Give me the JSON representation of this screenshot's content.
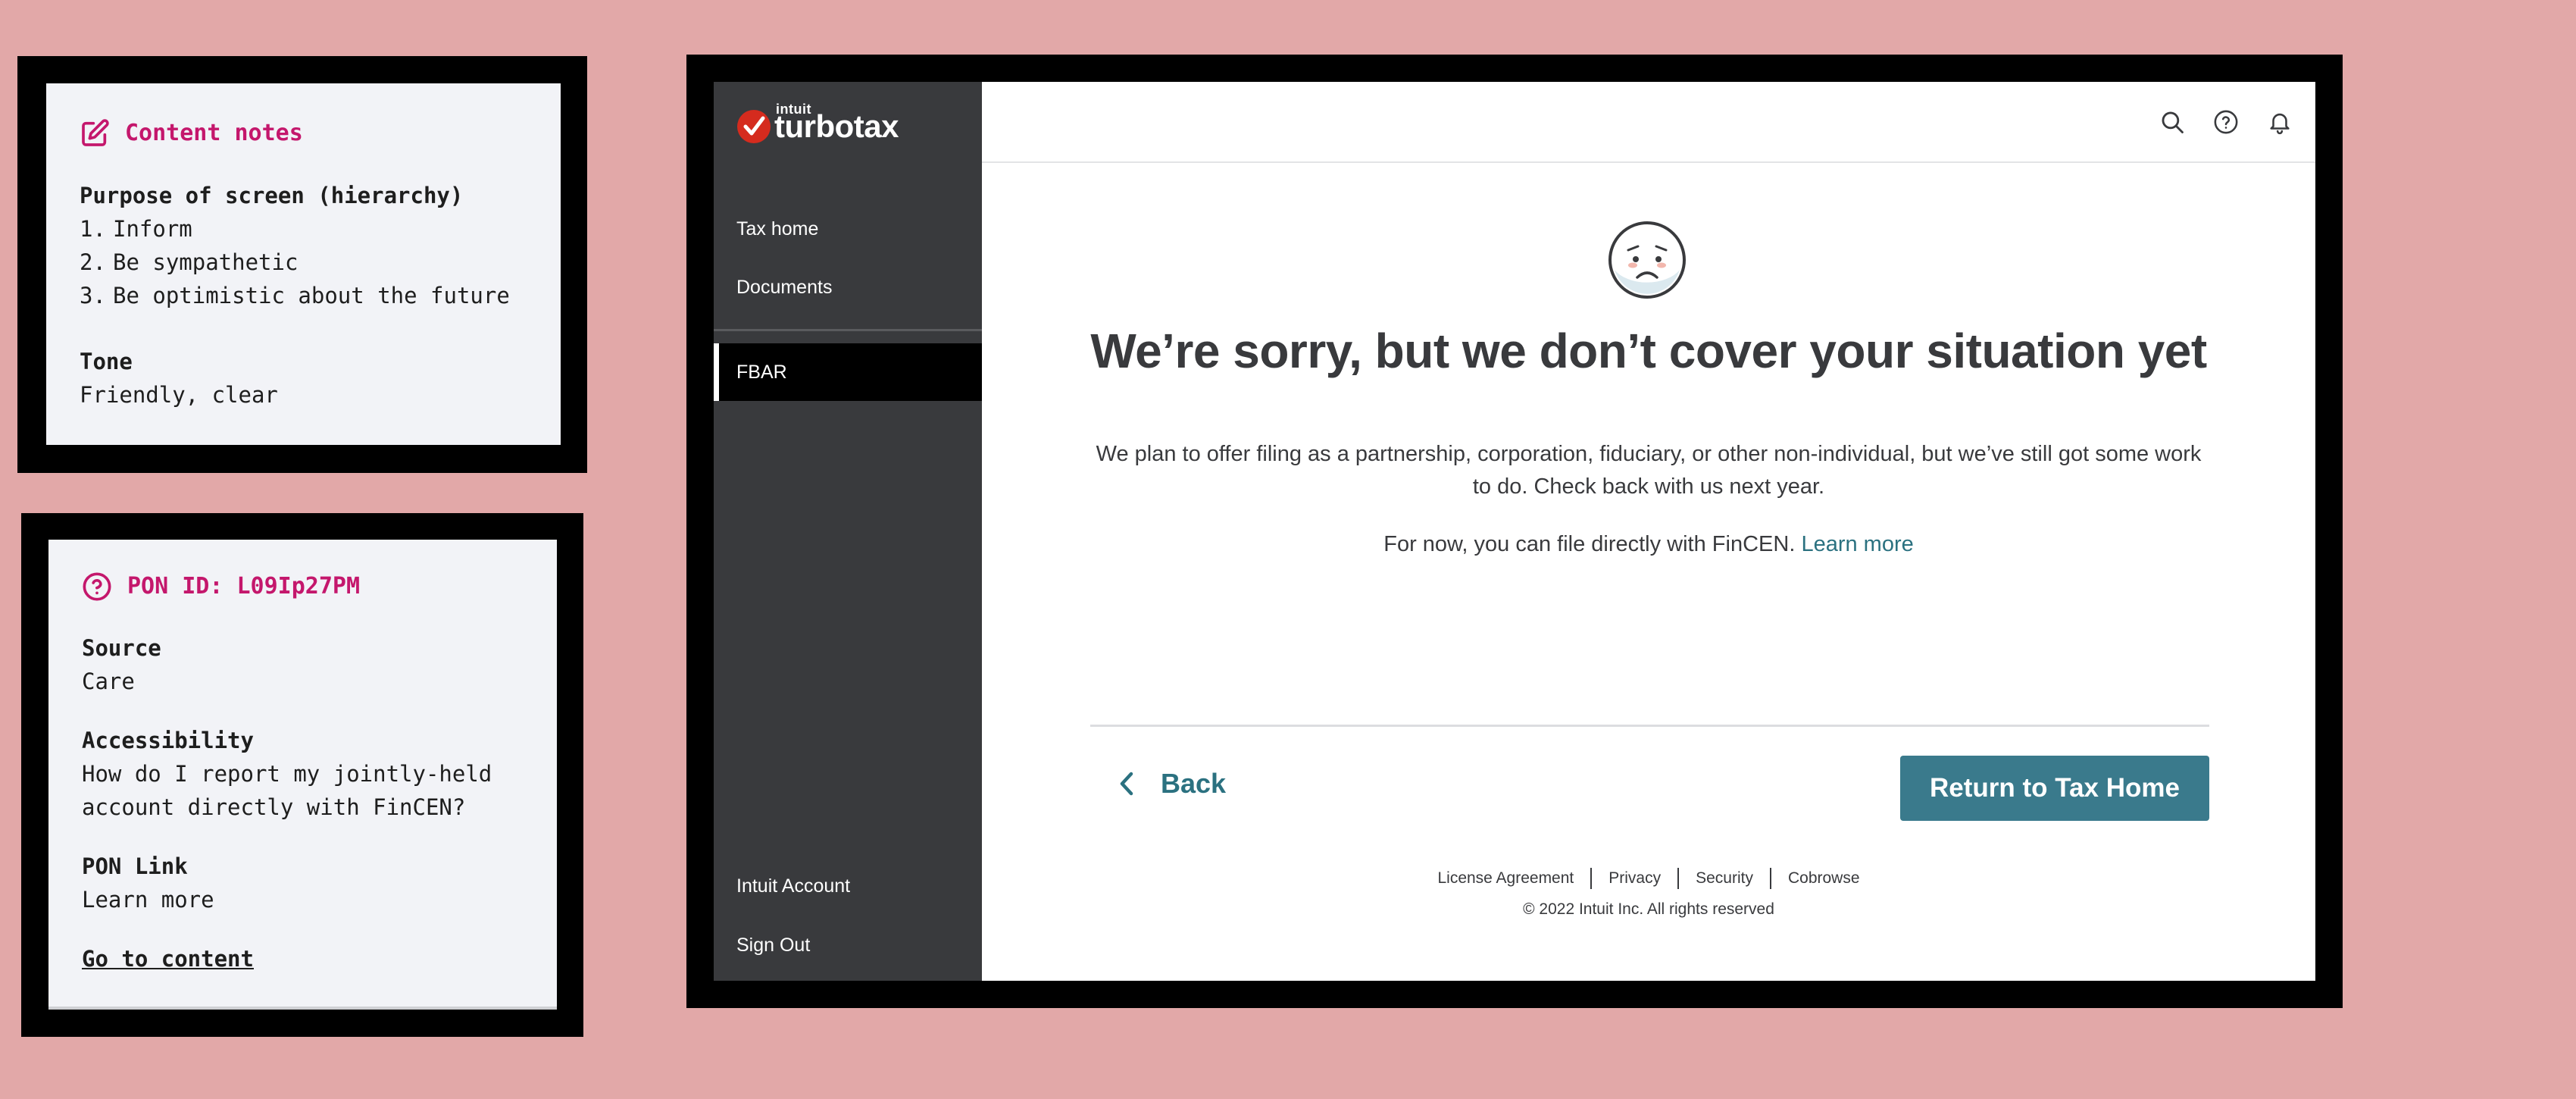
{
  "content_notes": {
    "title": "Content notes",
    "purpose_label": "Purpose of screen (hierarchy)",
    "purpose_items": [
      {
        "num": "1.",
        "text": "Inform"
      },
      {
        "num": "2.",
        "text": "Be sympathetic"
      },
      {
        "num": "3.",
        "text": "Be optimistic about the future"
      }
    ],
    "tone_label": "Tone",
    "tone_value": "Friendly, clear",
    "icon": "edit-icon"
  },
  "pon_card": {
    "title": "PON ID: L09Ip27PM",
    "icon": "help-circle-icon",
    "source_label": "Source",
    "source_value": "Care",
    "accessibility_label": "Accessibility",
    "accessibility_line1": "How do I report my jointly-held",
    "accessibility_line2": "account directly with FinCEN?",
    "pon_link_label": "PON Link",
    "pon_link_value": "Learn more",
    "go_link": "Go to content"
  },
  "app": {
    "logo_small": "intuit",
    "logo_main": "turbotax",
    "sidebar": {
      "tax_home": "Tax home",
      "documents": "Documents",
      "active": "FBAR",
      "account": "Intuit Account",
      "sign_out": "Sign Out"
    },
    "header_icons": [
      "search-icon",
      "help-icon",
      "bell-icon"
    ],
    "headline": "We’re sorry, but we don’t cover your situation yet",
    "body_text": "We plan to offer filing as a partnership, corporation, fiduciary, or other non-individual, but we’ve still got some work to do. Check back with us next year.",
    "body_text2": "For now, you can file directly with FinCEN.",
    "learn_more": "Learn more",
    "back_label": "Back",
    "primary_label": "Return to Tax Home",
    "footer": {
      "links": [
        "License Agreement",
        "Privacy",
        "Security",
        "Cobrowse"
      ],
      "copyright": "© 2022 Intuit Inc.  All rights reserved"
    }
  },
  "colors": {
    "background": "#e2a8a8",
    "accent_pink": "#c4176c",
    "sidebar": "#393a3d",
    "primary_button": "#3a7a8c",
    "link": "#2b7180"
  }
}
